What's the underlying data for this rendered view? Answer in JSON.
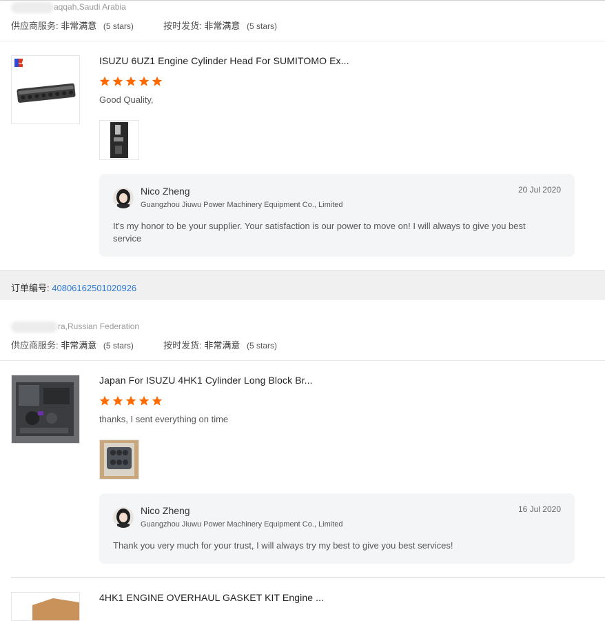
{
  "reviews": [
    {
      "location": "aqqah,Saudi Arabia",
      "supplier_service_label": "供应商服务:",
      "supplier_service_value": "非常满意",
      "supplier_service_stars": "(5 stars)",
      "ontime_label": "按时发货:",
      "ontime_value": "非常满意",
      "ontime_stars": "(5 stars)",
      "product_title": "ISUZU 6UZ1 Engine Cylinder Head For SUMITOMO Ex...",
      "rating": 5,
      "comment": "Good Quality,",
      "reply": {
        "name": "Nico Zheng",
        "company": "Guangzhou Jiuwu Power Machinery Equipment Co., Limited",
        "date": "20 Jul 2020",
        "text": "It's my honor to be your supplier. Your satisfaction is our power to move on! I will always to give you best service"
      }
    },
    {
      "order_label": "订单编号:",
      "order_number": "40806162501020926",
      "location": "ra,Russian Federation",
      "supplier_service_label": "供应商服务:",
      "supplier_service_value": "非常满意",
      "supplier_service_stars": "(5 stars)",
      "ontime_label": "按时发货:",
      "ontime_value": "非常满意",
      "ontime_stars": "(5 stars)",
      "product_title": "Japan For ISUZU 4HK1 Cylinder Long Block Br...",
      "rating": 5,
      "comment": "thanks, I sent everything on time",
      "reply": {
        "name": "Nico Zheng",
        "company": "Guangzhou Jiuwu Power Machinery Equipment Co., Limited",
        "date": "16 Jul 2020",
        "text": "Thank you very much for your trust, I will always try my best to give you best services!"
      }
    },
    {
      "product_title": "4HK1 ENGINE OVERHAUL GASKET KIT Engine ..."
    }
  ],
  "colors": {
    "star": "#ff6a00",
    "link": "#2f7bd3"
  }
}
